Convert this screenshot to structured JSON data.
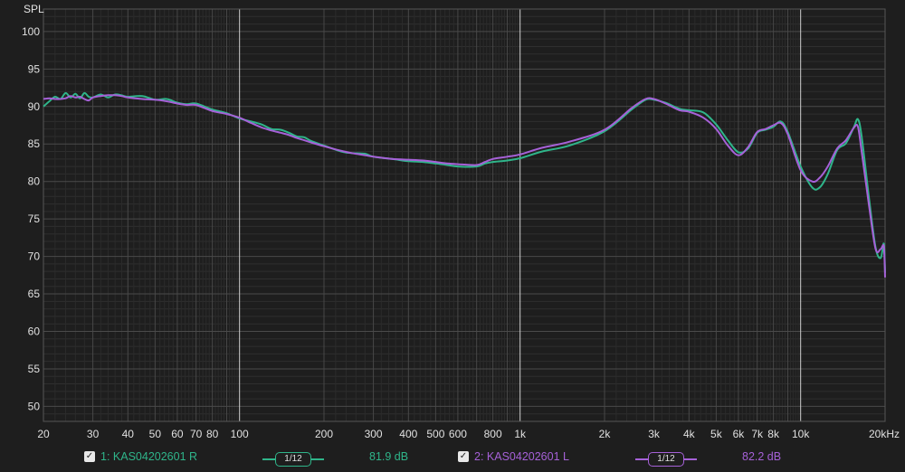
{
  "chart_data": {
    "type": "line",
    "ylabel": "SPL",
    "x_scale": "log",
    "xlim": [
      20,
      20000
    ],
    "ylim": [
      48,
      103
    ],
    "y_ticks": [
      50,
      55,
      60,
      65,
      70,
      75,
      80,
      85,
      90,
      95,
      100
    ],
    "x_tick_labels": [
      {
        "f": 20,
        "label": "20"
      },
      {
        "f": 30,
        "label": "30"
      },
      {
        "f": 40,
        "label": "40"
      },
      {
        "f": 50,
        "label": "50"
      },
      {
        "f": 60,
        "label": "60"
      },
      {
        "f": 70,
        "label": "70"
      },
      {
        "f": 80,
        "label": "80"
      },
      {
        "f": 100,
        "label": "100"
      },
      {
        "f": 200,
        "label": "200"
      },
      {
        "f": 300,
        "label": "300"
      },
      {
        "f": 400,
        "label": "400"
      },
      {
        "f": 500,
        "label": "500"
      },
      {
        "f": 600,
        "label": "600"
      },
      {
        "f": 800,
        "label": "800"
      },
      {
        "f": 1000,
        "label": "1k"
      },
      {
        "f": 2000,
        "label": "2k"
      },
      {
        "f": 3000,
        "label": "3k"
      },
      {
        "f": 4000,
        "label": "4k"
      },
      {
        "f": 5000,
        "label": "5k"
      },
      {
        "f": 6000,
        "label": "6k"
      },
      {
        "f": 7000,
        "label": "7k"
      },
      {
        "f": 8000,
        "label": "8k"
      },
      {
        "f": 10000,
        "label": "10k"
      },
      {
        "f": 20000,
        "label": "20kHz"
      }
    ],
    "grid": true,
    "series": [
      {
        "name": "1: KAS04202601 R",
        "color": "#2fb58a",
        "smoothing": "1/12",
        "level": "81.9 dB",
        "points": [
          [
            20,
            90.0
          ],
          [
            21,
            90.7
          ],
          [
            22,
            91.3
          ],
          [
            23,
            91.0
          ],
          [
            24,
            91.8
          ],
          [
            25,
            91.2
          ],
          [
            26,
            91.7
          ],
          [
            27,
            91.1
          ],
          [
            28,
            91.8
          ],
          [
            29,
            91.3
          ],
          [
            30,
            91.2
          ],
          [
            32,
            91.6
          ],
          [
            34,
            91.2
          ],
          [
            36,
            91.6
          ],
          [
            38,
            91.5
          ],
          [
            40,
            91.3
          ],
          [
            45,
            91.4
          ],
          [
            50,
            90.9
          ],
          [
            55,
            91.0
          ],
          [
            60,
            90.5
          ],
          [
            65,
            90.3
          ],
          [
            70,
            90.4
          ],
          [
            80,
            89.6
          ],
          [
            90,
            89.1
          ],
          [
            100,
            88.4
          ],
          [
            110,
            88.0
          ],
          [
            120,
            87.6
          ],
          [
            130,
            87.0
          ],
          [
            140,
            86.9
          ],
          [
            150,
            86.5
          ],
          [
            160,
            86.0
          ],
          [
            170,
            85.9
          ],
          [
            180,
            85.4
          ],
          [
            200,
            84.8
          ],
          [
            230,
            84.0
          ],
          [
            250,
            83.8
          ],
          [
            280,
            83.7
          ],
          [
            300,
            83.3
          ],
          [
            350,
            83.0
          ],
          [
            400,
            82.7
          ],
          [
            450,
            82.6
          ],
          [
            500,
            82.4
          ],
          [
            550,
            82.2
          ],
          [
            600,
            82.0
          ],
          [
            700,
            82.0
          ],
          [
            750,
            82.4
          ],
          [
            800,
            82.6
          ],
          [
            900,
            82.8
          ],
          [
            1000,
            83.1
          ],
          [
            1200,
            84.0
          ],
          [
            1500,
            84.8
          ],
          [
            2000,
            86.7
          ],
          [
            2500,
            89.6
          ],
          [
            2800,
            90.9
          ],
          [
            3000,
            90.9
          ],
          [
            3300,
            90.5
          ],
          [
            3700,
            89.7
          ],
          [
            4000,
            89.5
          ],
          [
            4500,
            89.2
          ],
          [
            5000,
            87.6
          ],
          [
            5500,
            85.5
          ],
          [
            6000,
            83.9
          ],
          [
            6500,
            84.4
          ],
          [
            7000,
            86.5
          ],
          [
            7500,
            86.9
          ],
          [
            8000,
            87.3
          ],
          [
            8500,
            88.0
          ],
          [
            9000,
            86.6
          ],
          [
            10000,
            82.0
          ],
          [
            11000,
            79.2
          ],
          [
            11700,
            79.2
          ],
          [
            12500,
            81.0
          ],
          [
            13500,
            84.2
          ],
          [
            14500,
            85.1
          ],
          [
            15500,
            87.3
          ],
          [
            16000,
            88.3
          ],
          [
            16500,
            86.0
          ],
          [
            17500,
            78.0
          ],
          [
            18500,
            71.2
          ],
          [
            19300,
            69.8
          ],
          [
            19800,
            71.7
          ],
          [
            20000,
            67.8
          ]
        ]
      },
      {
        "name": "2: KAS04202601 L",
        "color": "#a661d8",
        "smoothing": "1/12",
        "level": "82.2 dB",
        "points": [
          [
            20,
            91.0
          ],
          [
            21,
            91.1
          ],
          [
            22,
            91.0
          ],
          [
            23,
            91.0
          ],
          [
            24,
            91.1
          ],
          [
            25,
            91.4
          ],
          [
            26,
            91.2
          ],
          [
            27,
            91.3
          ],
          [
            28,
            91.0
          ],
          [
            29,
            90.8
          ],
          [
            30,
            91.2
          ],
          [
            32,
            91.4
          ],
          [
            34,
            91.5
          ],
          [
            36,
            91.5
          ],
          [
            38,
            91.4
          ],
          [
            40,
            91.2
          ],
          [
            45,
            91.0
          ],
          [
            50,
            90.9
          ],
          [
            55,
            90.7
          ],
          [
            60,
            90.4
          ],
          [
            65,
            90.2
          ],
          [
            70,
            90.2
          ],
          [
            80,
            89.4
          ],
          [
            90,
            89.0
          ],
          [
            100,
            88.5
          ],
          [
            110,
            87.8
          ],
          [
            120,
            87.2
          ],
          [
            130,
            86.8
          ],
          [
            140,
            86.5
          ],
          [
            150,
            86.2
          ],
          [
            160,
            85.8
          ],
          [
            170,
            85.5
          ],
          [
            180,
            85.2
          ],
          [
            200,
            84.7
          ],
          [
            230,
            84.1
          ],
          [
            250,
            83.8
          ],
          [
            280,
            83.5
          ],
          [
            300,
            83.3
          ],
          [
            350,
            83.0
          ],
          [
            400,
            82.9
          ],
          [
            450,
            82.8
          ],
          [
            500,
            82.6
          ],
          [
            550,
            82.4
          ],
          [
            600,
            82.3
          ],
          [
            700,
            82.2
          ],
          [
            750,
            82.6
          ],
          [
            800,
            83.0
          ],
          [
            900,
            83.3
          ],
          [
            1000,
            83.6
          ],
          [
            1200,
            84.5
          ],
          [
            1500,
            85.3
          ],
          [
            2000,
            86.9
          ],
          [
            2500,
            89.8
          ],
          [
            2800,
            91.0
          ],
          [
            3000,
            91.0
          ],
          [
            3300,
            90.4
          ],
          [
            3700,
            89.5
          ],
          [
            4000,
            89.3
          ],
          [
            4500,
            88.5
          ],
          [
            5000,
            87.0
          ],
          [
            5500,
            84.8
          ],
          [
            6000,
            83.5
          ],
          [
            6500,
            84.6
          ],
          [
            7000,
            86.6
          ],
          [
            7500,
            87.0
          ],
          [
            8000,
            87.5
          ],
          [
            8500,
            87.8
          ],
          [
            9000,
            86.3
          ],
          [
            10000,
            81.5
          ],
          [
            11000,
            80.0
          ],
          [
            11700,
            80.5
          ],
          [
            12500,
            82.0
          ],
          [
            13500,
            84.4
          ],
          [
            14500,
            85.5
          ],
          [
            15500,
            87.2
          ],
          [
            16000,
            87.3
          ],
          [
            16500,
            84.0
          ],
          [
            17500,
            77.0
          ],
          [
            18500,
            71.0
          ],
          [
            19300,
            71.0
          ],
          [
            19800,
            71.3
          ],
          [
            20000,
            67.2
          ]
        ]
      }
    ]
  }
}
